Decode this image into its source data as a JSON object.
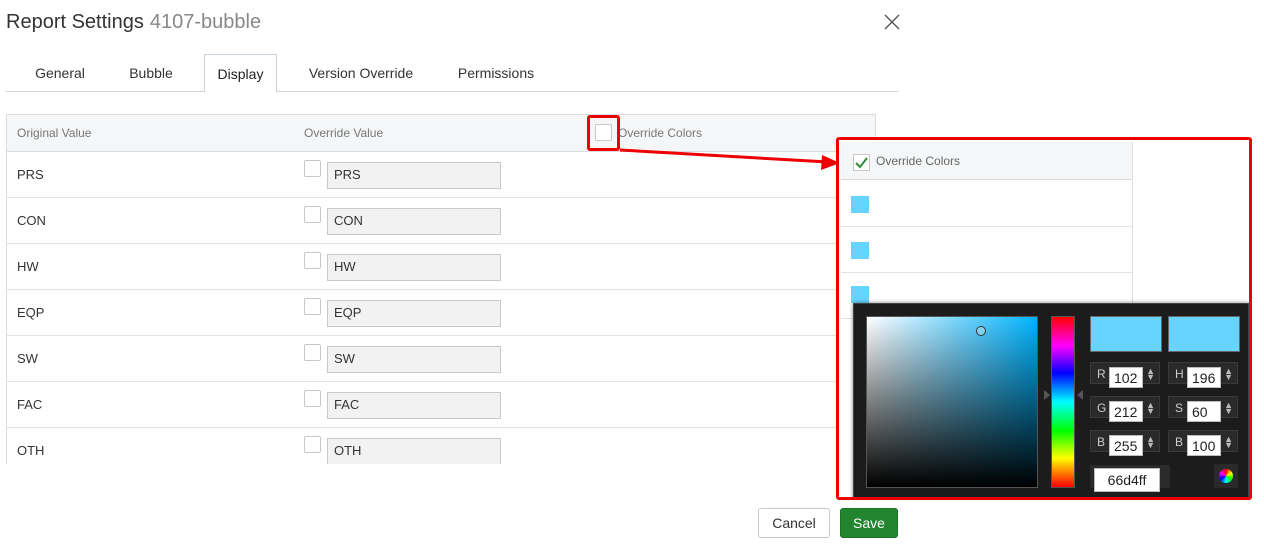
{
  "dialog": {
    "title": "Report Settings",
    "subtitle": "4107-bubble",
    "close_icon": "close-icon"
  },
  "tabs": [
    {
      "label": "General",
      "active": false
    },
    {
      "label": "Bubble",
      "active": false
    },
    {
      "label": "Display",
      "active": true
    },
    {
      "label": "Version Override",
      "active": false
    },
    {
      "label": "Permissions",
      "active": false
    }
  ],
  "table": {
    "headers": {
      "original": "Original Value",
      "override": "Override Value",
      "override_colors": "Override Colors"
    },
    "rows": [
      {
        "original": "PRS",
        "override": "PRS",
        "checked": false
      },
      {
        "original": "CON",
        "override": "CON",
        "checked": false
      },
      {
        "original": "HW",
        "override": "HW",
        "checked": false
      },
      {
        "original": "EQP",
        "override": "EQP",
        "checked": false
      },
      {
        "original": "SW",
        "override": "SW",
        "checked": false
      },
      {
        "original": "FAC",
        "override": "FAC",
        "checked": false
      },
      {
        "original": "OTH",
        "override": "OTH",
        "checked": false
      }
    ]
  },
  "zoom": {
    "header": "Override Colors",
    "checked": true,
    "swatch_color": "#66d4ff"
  },
  "color_picker": {
    "current_color": "#66d4ff",
    "previous_color": "#66d4ff",
    "r": "102",
    "g": "212",
    "b": "255",
    "h": "196",
    "s": "60",
    "brightness": "100",
    "hex": "66d4ff",
    "labels": {
      "r": "R",
      "g": "G",
      "b": "B",
      "h": "H",
      "s": "S",
      "brightness": "B"
    }
  },
  "footer": {
    "cancel_label": "Cancel",
    "save_label": "Save"
  },
  "colors": {
    "highlight": "#e00000",
    "save": "#23842f"
  }
}
